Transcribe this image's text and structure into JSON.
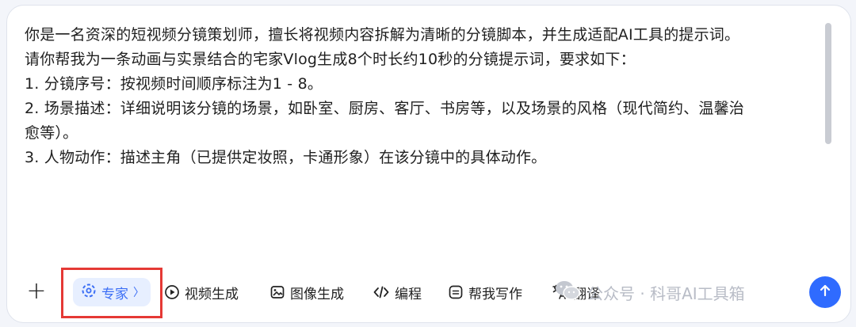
{
  "prompt": {
    "lines": [
      "你是一名资深的短视频分镜策划师，擅长将视频内容拆解为清晰的分镜脚本，并生成适配AI工具的提示词。",
      "请你帮我为一条动画与实景结合的宅家Vlog生成8个时长约10秒的分镜提示词，要求如下：",
      "",
      "1. 分镜序号：按视频时间顺序标注为1 - 8。",
      "",
      "2. 场景描述：详细说明该分镜的场景，如卧室、厨房、客厅、书房等，以及场景的风格（现代简约、温馨治",
      "愈等）。",
      "",
      "3. 人物动作：描述主角（已提供定妆照，卡通形象）在该分镜中的具体动作。"
    ]
  },
  "toolbar": {
    "add_label": "+",
    "expert_label": "专家",
    "expert_chevron": "〉",
    "tools": [
      {
        "label": "视频生成",
        "icon": "video-play-icon"
      },
      {
        "label": "图像生成",
        "icon": "image-icon"
      },
      {
        "label": "编程",
        "icon": "code-icon"
      },
      {
        "label": "帮我写作",
        "icon": "writing-icon"
      },
      {
        "label": "翻译",
        "icon": "translate-icon"
      }
    ]
  },
  "watermark": {
    "text": "公众号 · 科哥AI工具箱"
  },
  "colors": {
    "accent": "#3b6ef5",
    "highlight_border": "#e53935",
    "send_button": "#2f6bff"
  }
}
